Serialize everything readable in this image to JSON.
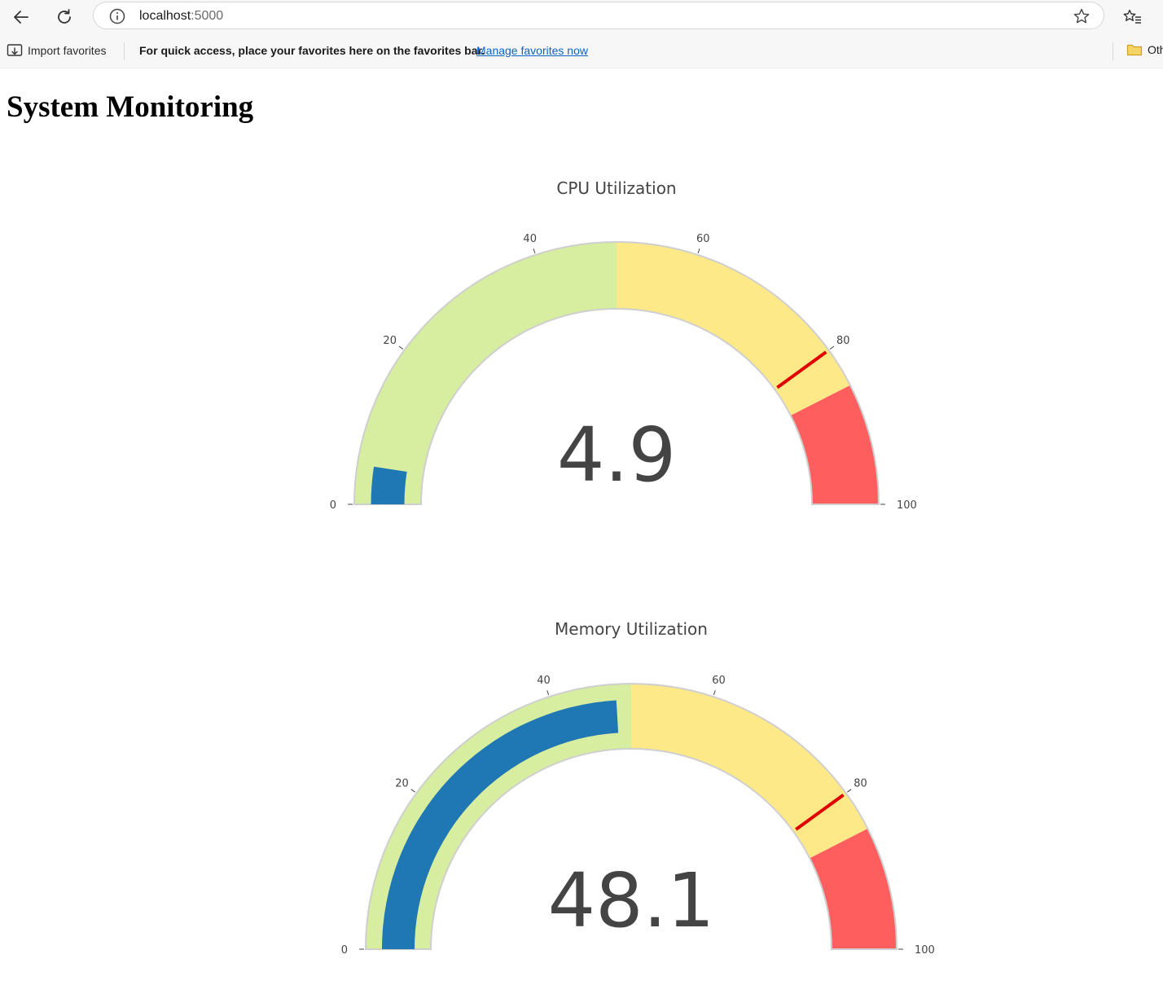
{
  "browser": {
    "url_host": "localhost",
    "url_port": ":5000",
    "favorites": {
      "import_label": "Import favorites",
      "message": "For quick access, place your favorites here on the favorites bar.",
      "manage_link": "Manage favorites now",
      "other_label": "Oth"
    }
  },
  "page": {
    "title": "System Monitoring"
  },
  "gauges": [
    {
      "title": "CPU Utilization",
      "value": 4.9,
      "display": "4.9",
      "range": [
        0,
        100
      ],
      "threshold": 80,
      "ticks": [
        0,
        20,
        40,
        60,
        80,
        100
      ],
      "steps": [
        {
          "from": 0,
          "to": 50,
          "color": "#d7ed9f"
        },
        {
          "from": 50,
          "to": 85,
          "color": "#fde987"
        },
        {
          "from": 85,
          "to": 100,
          "color": "#fe5f5e"
        }
      ],
      "bar_color": "#1f77b4",
      "threshold_color": "#e00000"
    },
    {
      "title": "Memory Utilization",
      "value": 48.1,
      "display": "48.1",
      "range": [
        0,
        100
      ],
      "threshold": 80,
      "ticks": [
        0,
        20,
        40,
        60,
        80,
        100
      ],
      "steps": [
        {
          "from": 0,
          "to": 50,
          "color": "#d7ed9f"
        },
        {
          "from": 50,
          "to": 85,
          "color": "#fde987"
        },
        {
          "from": 85,
          "to": 100,
          "color": "#fe5f5e"
        }
      ],
      "bar_color": "#1f77b4",
      "threshold_color": "#e00000"
    }
  ]
}
